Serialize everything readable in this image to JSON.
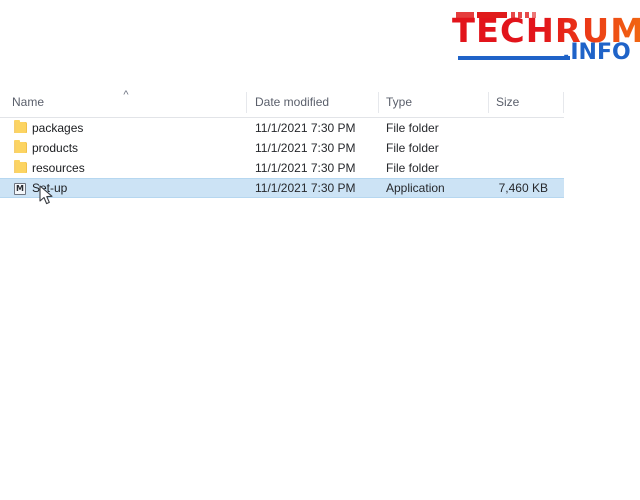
{
  "watermark": {
    "brand": "TECHRUM",
    "suffix": ".INFO",
    "brand_color": "#e2141b",
    "brand_color_end": "#f26a11",
    "suffix_color": "#1f63c8"
  },
  "explorer": {
    "sort_indicator": "^",
    "columns": [
      {
        "key": "name",
        "label": "Name"
      },
      {
        "key": "date",
        "label": "Date modified"
      },
      {
        "key": "type",
        "label": "Type"
      },
      {
        "key": "size",
        "label": "Size"
      }
    ],
    "selection_color": "#cce3f5",
    "rows": [
      {
        "name": "packages",
        "date": "11/1/2021 7:30 PM",
        "type": "File folder",
        "size": "",
        "icon": "folder-icon",
        "selected": false
      },
      {
        "name": "products",
        "date": "11/1/2021 7:30 PM",
        "type": "File folder",
        "size": "",
        "icon": "folder-icon",
        "selected": false
      },
      {
        "name": "resources",
        "date": "11/1/2021 7:30 PM",
        "type": "File folder",
        "size": "",
        "icon": "folder-icon",
        "selected": false
      },
      {
        "name": "Set-up",
        "date": "11/1/2021 7:30 PM",
        "type": "Application",
        "size": "7,460 KB",
        "icon": "application-icon",
        "icon_glyph": "M",
        "selected": true
      }
    ]
  }
}
